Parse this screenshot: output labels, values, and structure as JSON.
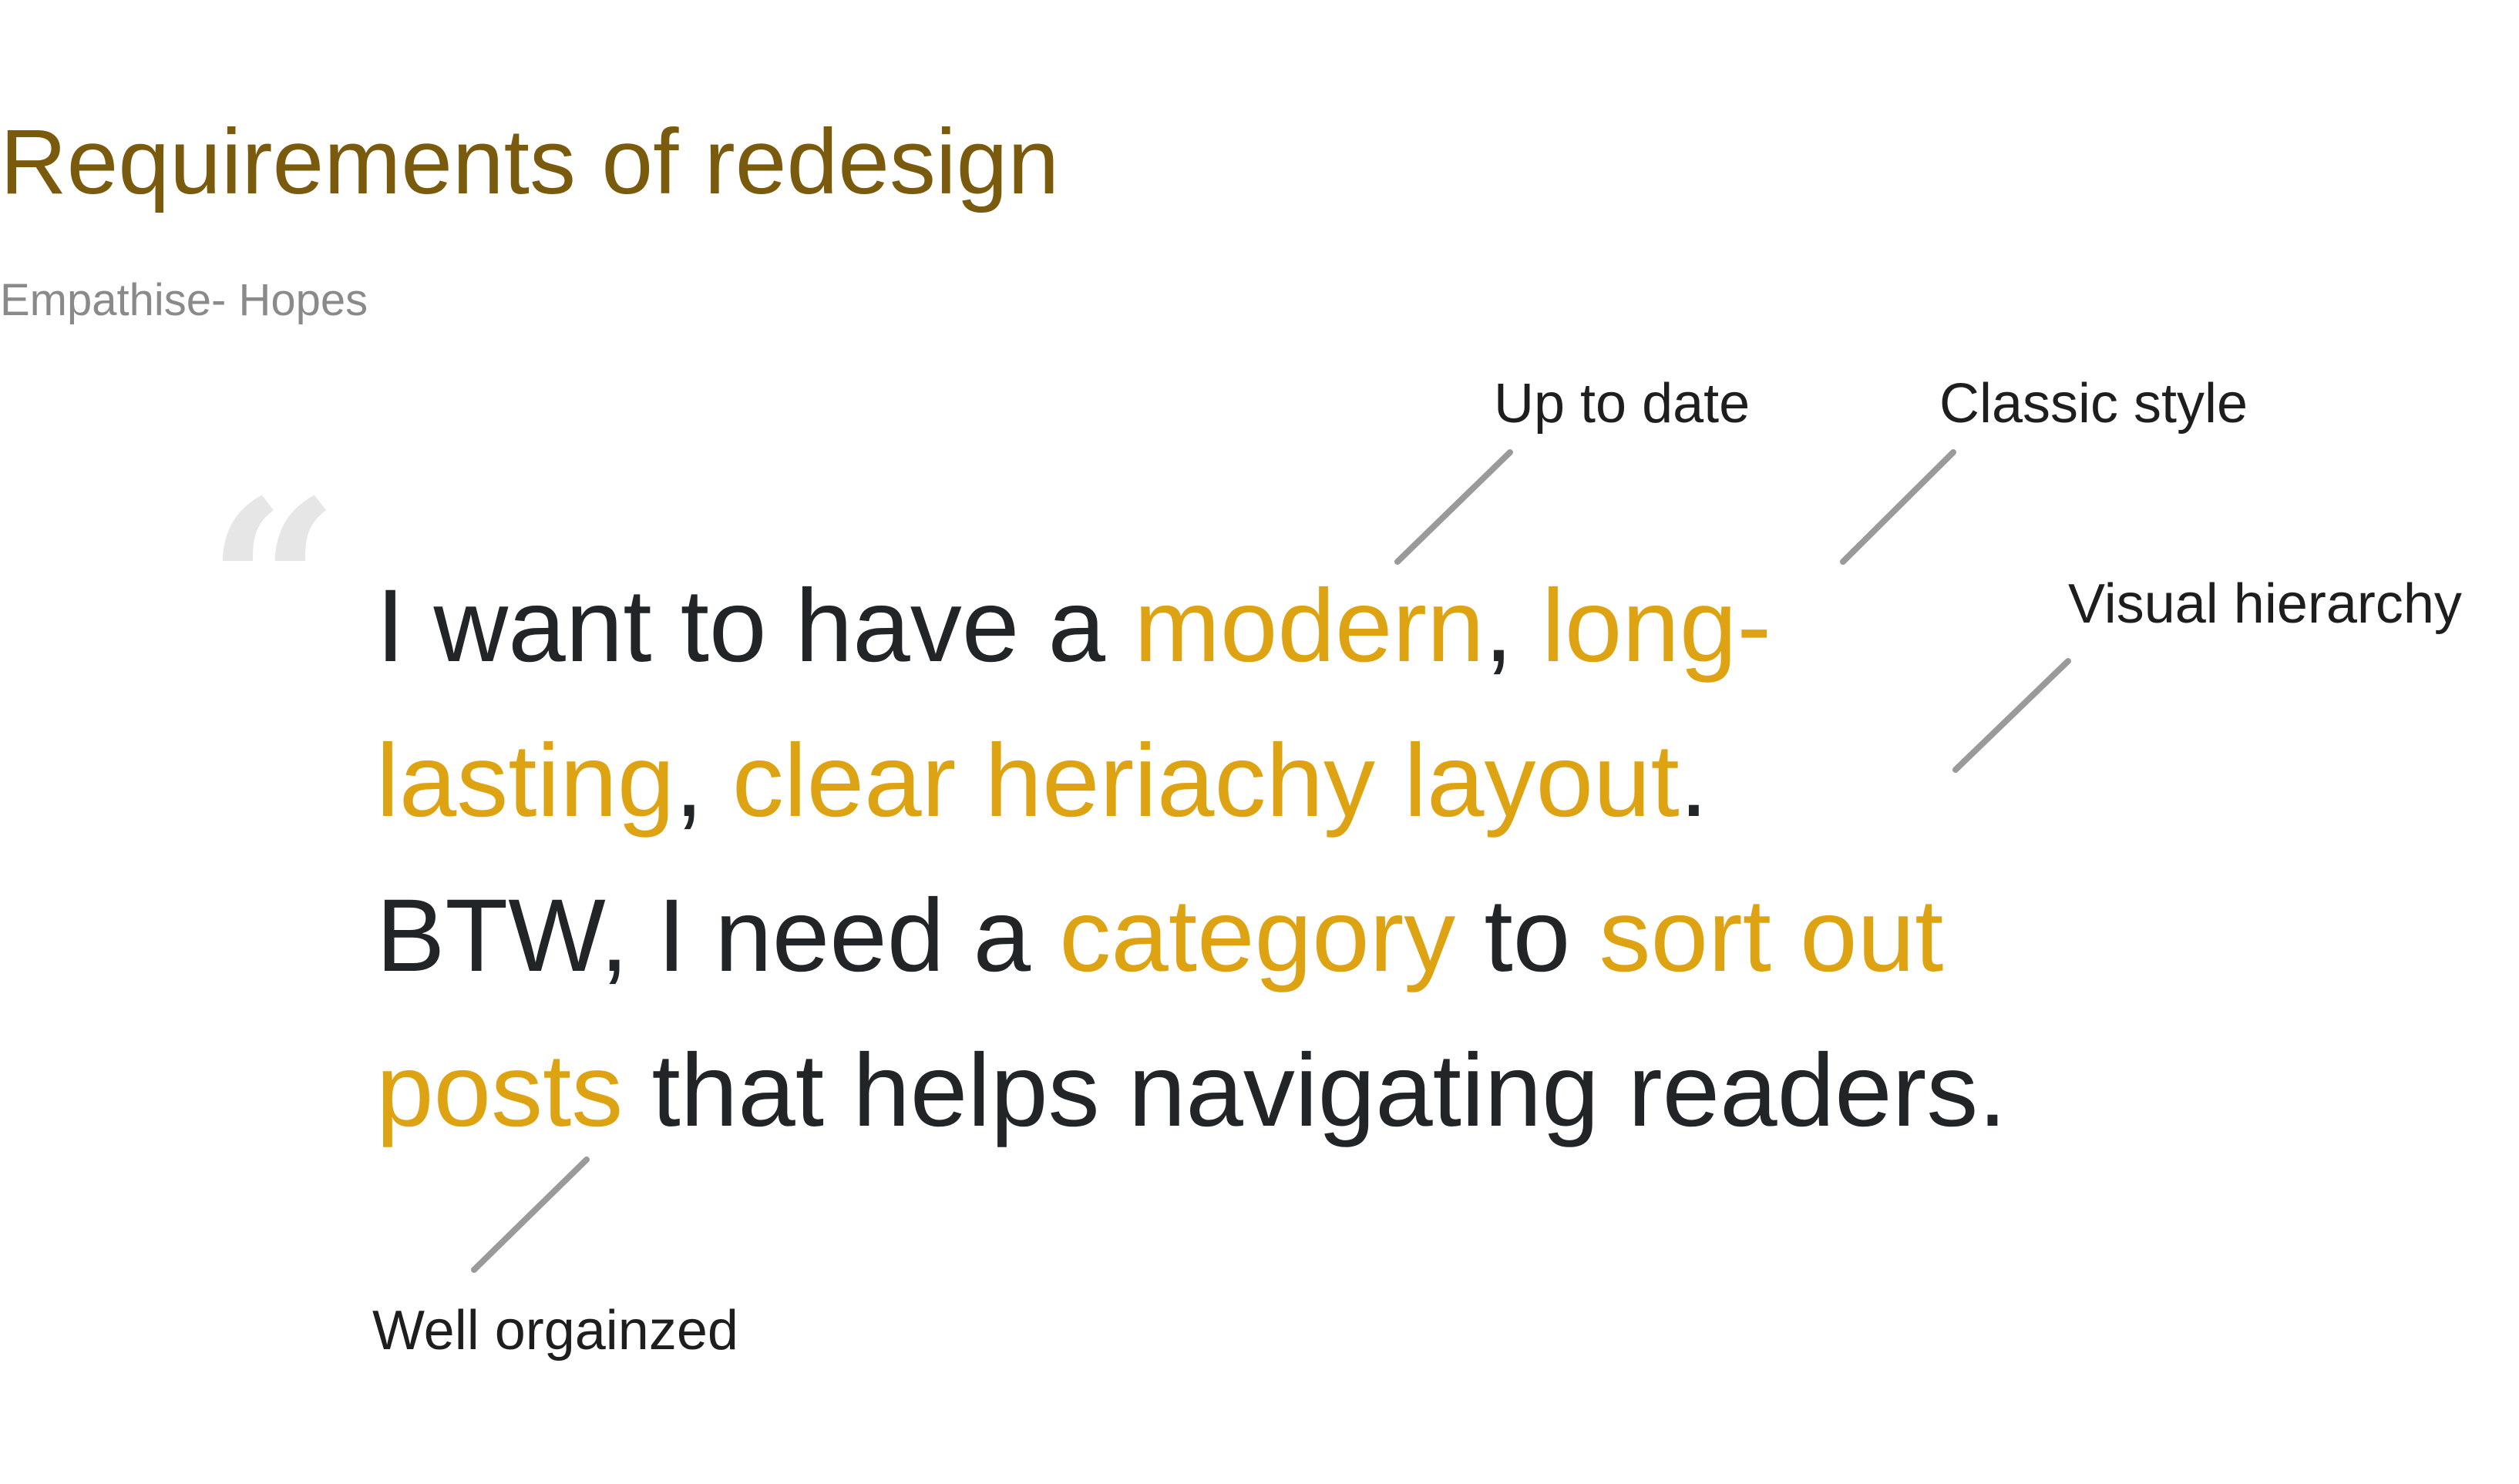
{
  "title": "Requirements of redesign",
  "subtitle": "Empathise- Hopes",
  "quote_mark": "“",
  "quote": {
    "line1": [
      {
        "text": "I want to have a ",
        "highlight": false
      },
      {
        "text": "modern",
        "highlight": true
      },
      {
        "text": ", ",
        "highlight": false
      },
      {
        "text": "long-",
        "highlight": true
      }
    ],
    "line2": [
      {
        "text": "lasting",
        "highlight": true
      },
      {
        "text": ", ",
        "highlight": false
      },
      {
        "text": "clear heriachy layout",
        "highlight": true
      },
      {
        "text": ".",
        "highlight": false
      }
    ],
    "line3": [
      {
        "text": "BTW, I need a ",
        "highlight": false
      },
      {
        "text": "category",
        "highlight": true
      },
      {
        "text": " to ",
        "highlight": false
      },
      {
        "text": "sort out",
        "highlight": true
      }
    ],
    "line4": [
      {
        "text": "posts",
        "highlight": true
      },
      {
        "text": " that helps navigating readers.",
        "highlight": false
      }
    ]
  },
  "annotations": {
    "up_to_date": "Up to date",
    "classic_style": "Classic style",
    "visual_hierarchy": "Visual hierarchy",
    "well_organized": "Well orgainzed"
  },
  "colors": {
    "title": "#7a5a0c",
    "subtitle": "#8a8a8a",
    "quote_mark": "#e6e6e6",
    "text": "#222528",
    "highlight": "#dea313",
    "annotation": "#1e1e1e",
    "leader_line": "#9a9a9a"
  }
}
